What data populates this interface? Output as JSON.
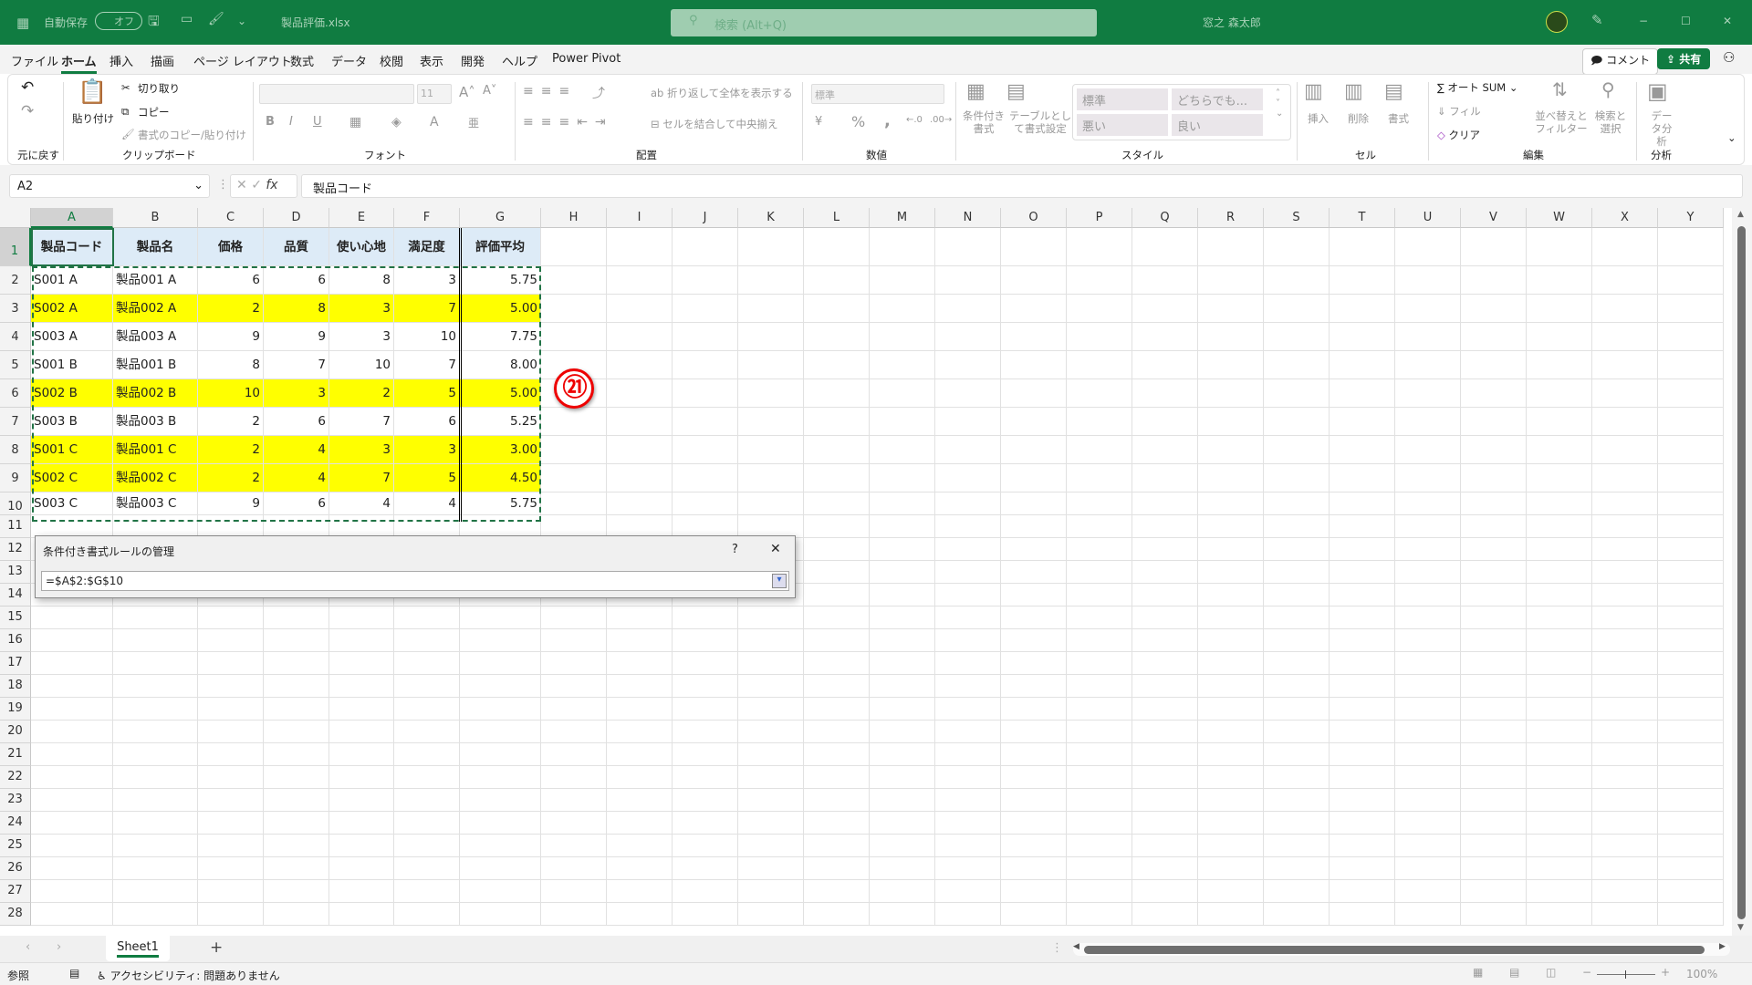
{
  "titlebar": {
    "autosave": "自動保存",
    "toggle": "オフ",
    "filename": "製品評価.xlsx",
    "search_placeholder": "検索 (Alt+Q)",
    "user": "窓之 森太郎",
    "minimize": "−",
    "maximize": "☐",
    "close": "✕"
  },
  "menu": {
    "items": [
      "ファイル",
      "ホーム",
      "挿入",
      "描画",
      "ページ レイアウト",
      "数式",
      "データ",
      "校閲",
      "表示",
      "開発",
      "ヘルプ",
      "Power Pivot"
    ],
    "active": "ホーム",
    "comment": "コメント",
    "share": "共有"
  },
  "ribbon": {
    "undo_group": "元に戻す",
    "clipboard": {
      "label": "クリップボード",
      "paste": "貼り付け",
      "cut": "切り取り",
      "copy": "コピー",
      "format_painter": "書式のコピー/貼り付け"
    },
    "font": {
      "label": "フォント",
      "size": "11",
      "bold": "B",
      "italic": "I",
      "underline": "U"
    },
    "alignment": {
      "label": "配置",
      "wrap": "折り返して全体を表示する",
      "merge": "セルを結合して中央揃え"
    },
    "number": {
      "label": "数値",
      "format": "標準",
      "percent": "%",
      "comma": ","
    },
    "styles": {
      "label": "スタイル",
      "conditional": "条件付き書式",
      "table": "テーブルとして書式設定",
      "cells": [
        "標準",
        "どちらでも...",
        "悪い",
        "良い"
      ]
    },
    "cells": {
      "label": "セル",
      "insert": "挿入",
      "delete": "削除",
      "format": "書式"
    },
    "editing": {
      "label": "編集",
      "autosum": "オート SUM",
      "fill": "フィル",
      "clear": "クリア",
      "sort": "並べ替えとフィルター",
      "find": "検索と選択"
    },
    "analysis": {
      "label": "分析",
      "data_analysis": "データ分析"
    }
  },
  "formula_bar": {
    "name_box": "A2",
    "fx": "fx",
    "value": "製品コード"
  },
  "sheet": {
    "columns": [
      "A",
      "B",
      "C",
      "D",
      "E",
      "F",
      "G",
      "H",
      "I",
      "J",
      "K",
      "L",
      "M",
      "N",
      "O",
      "P",
      "Q",
      "R",
      "S",
      "T",
      "U",
      "V",
      "W",
      "X",
      "Y"
    ],
    "rows": [
      "1",
      "2",
      "3",
      "4",
      "5",
      "6",
      "7",
      "8",
      "9",
      "10",
      "11",
      "12",
      "13",
      "14",
      "15",
      "16",
      "17",
      "18",
      "19",
      "20",
      "21",
      "22",
      "23",
      "24",
      "25",
      "26",
      "27",
      "28"
    ],
    "headers": [
      "製品コード",
      "製品名",
      "価格",
      "品質",
      "使い心地",
      "満足度",
      "評価平均"
    ],
    "data": [
      [
        "S001 A",
        "製品001 A",
        "6",
        "6",
        "8",
        "3",
        "5.75"
      ],
      [
        "S002 A",
        "製品002 A",
        "2",
        "8",
        "3",
        "7",
        "5.00"
      ],
      [
        "S003 A",
        "製品003 A",
        "9",
        "9",
        "3",
        "10",
        "7.75"
      ],
      [
        "S001 B",
        "製品001 B",
        "8",
        "7",
        "10",
        "7",
        "8.00"
      ],
      [
        "S002 B",
        "製品002 B",
        "10",
        "3",
        "2",
        "5",
        "5.00"
      ],
      [
        "S003 B",
        "製品003 B",
        "2",
        "6",
        "7",
        "6",
        "5.25"
      ],
      [
        "S001 C",
        "製品001 C",
        "2",
        "4",
        "3",
        "3",
        "3.00"
      ],
      [
        "S002 C",
        "製品002 C",
        "2",
        "4",
        "7",
        "5",
        "4.50"
      ],
      [
        "S003 C",
        "製品003 C",
        "9",
        "6",
        "4",
        "4",
        "5.75"
      ]
    ],
    "highlighted_rows": [
      2,
      5,
      7,
      8
    ],
    "highlight_color": "#ffff00",
    "header_fill": "#ddebf7"
  },
  "annotation": "㉑",
  "dialog": {
    "title": "条件付き書式ルールの管理",
    "help": "?",
    "close": "✕",
    "range": "=$A$2:$G$10"
  },
  "tabs": {
    "sheets": [
      "Sheet1"
    ],
    "add": "+"
  },
  "status": {
    "mode": "参照",
    "accessibility": "アクセシビリティ: 問題ありません",
    "zoom": "100%"
  },
  "colors": {
    "accent": "#107c41"
  }
}
